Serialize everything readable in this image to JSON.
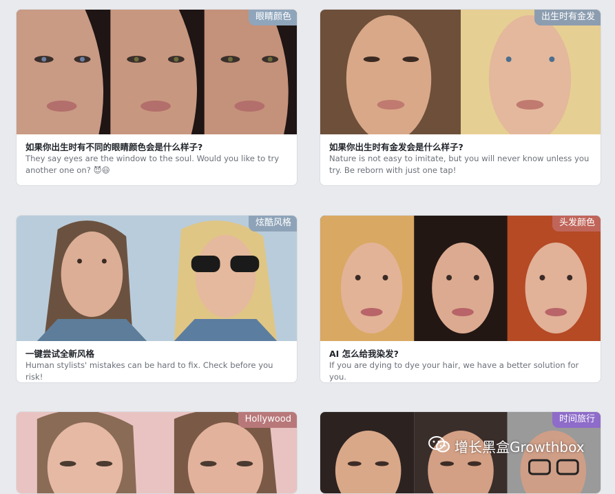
{
  "colors": {
    "background": "#e9eaee",
    "badge_eye": "#8fa5bb",
    "badge_blonde": "#8c9db0",
    "badge_cool": "#8ea3b8",
    "badge_hair": "#c0655a",
    "badge_hollywood": "#b8787a",
    "badge_time": "#8e6cc9"
  },
  "cards": [
    {
      "badge": "眼睛颜色",
      "title": "如果你出生时有不同的眼睛颜色会是什么样子?",
      "description": "They say eyes are the window to the soul. Would you like to try another one on? 😈😃",
      "image_icon": "three-faces-eye-color"
    },
    {
      "badge": "出生时有金发",
      "title": "如果你出生时有金发会是什么样子?",
      "description": "Nature is not easy to imitate, but you will never know unless you try. Be reborn with just one tap!",
      "image_icon": "two-faces-blonde"
    },
    {
      "badge": "炫酷风格",
      "title": "一键尝试全新风格",
      "description": "Human stylists' mistakes can be hard to fix. Check before you risk!",
      "image_icon": "two-faces-sunglasses"
    },
    {
      "badge": "头发颜色",
      "title": "AI 怎么给我染发?",
      "description": "If you are dying to dye your hair, we have a better solution for you.",
      "image_icon": "three-faces-hair-color"
    },
    {
      "badge": "Hollywood",
      "title": "",
      "description": "",
      "image_icon": "two-faces-hollywood"
    },
    {
      "badge": "时间旅行",
      "title": "",
      "description": "",
      "image_icon": "three-faces-aging"
    }
  ],
  "watermark": {
    "text": "增长黑盒Growthbox",
    "icon": "wechat-icon"
  }
}
